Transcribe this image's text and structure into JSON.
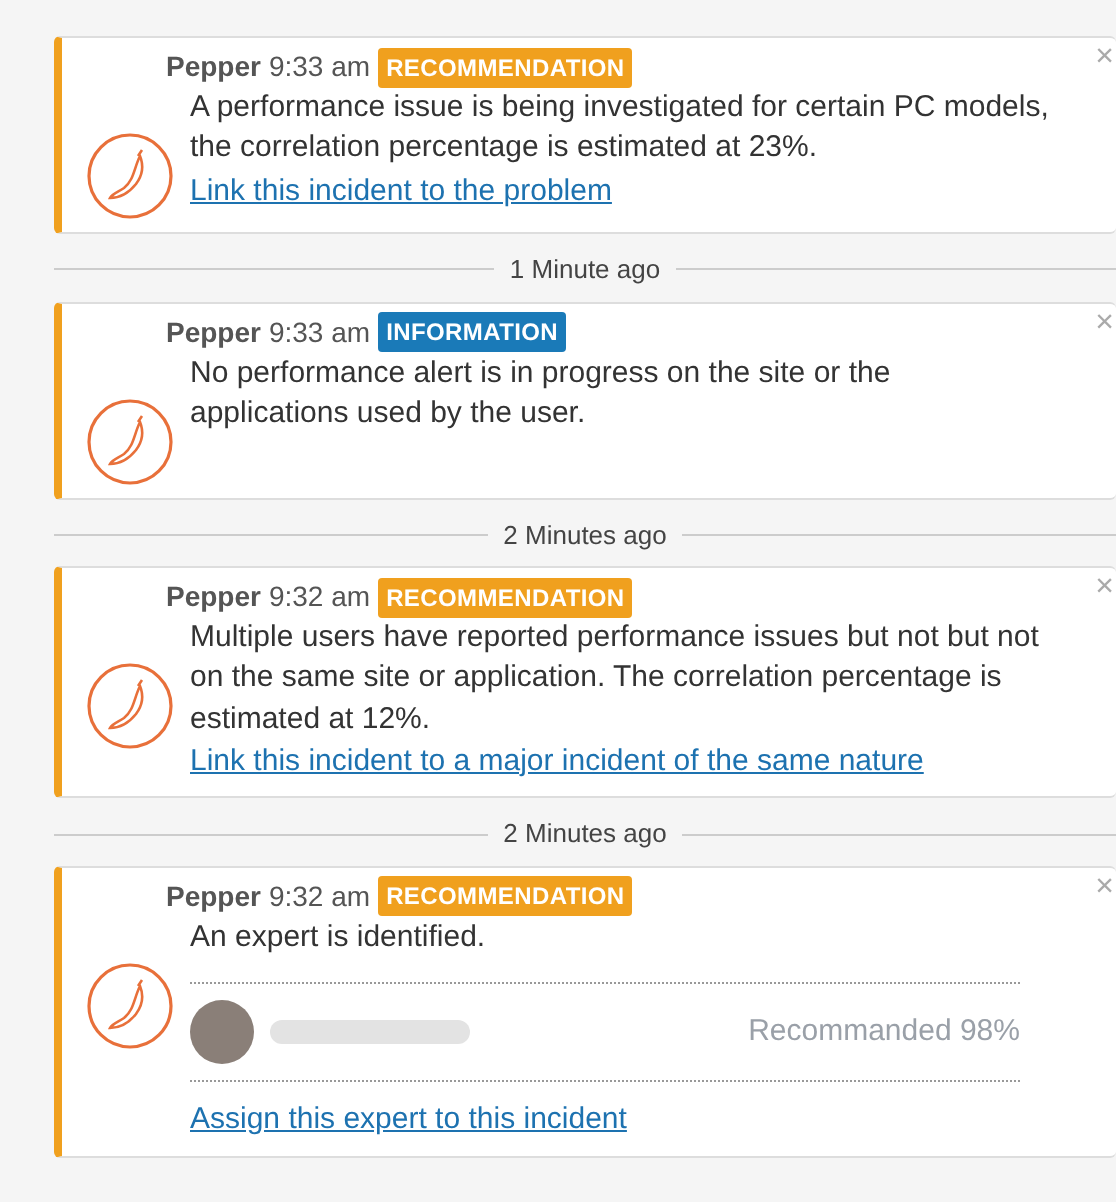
{
  "feed": [
    {
      "kind": "message",
      "author": "Pepper",
      "time": "9:33 am",
      "tag": {
        "label": "RECOMMENDATION",
        "kind": "recommendation"
      },
      "text": "A performance issue is being investigated for certain PC models, the correlation percentage is estimated at 23%.",
      "link": "Link this incident to the problem",
      "close": "×"
    },
    {
      "kind": "separator",
      "label": "1 Minute ago"
    },
    {
      "kind": "message",
      "author": "Pepper",
      "time": "9:33 am",
      "tag": {
        "label": "INFORMATION",
        "kind": "information"
      },
      "text": "No performance alert is in progress on the site or the applications used by the user.",
      "close": "×"
    },
    {
      "kind": "separator",
      "label": "2 Minutes ago"
    },
    {
      "kind": "message",
      "author": "Pepper",
      "time": "9:32 am",
      "tag": {
        "label": "RECOMMENDATION",
        "kind": "recommendation"
      },
      "text": "Multiple users have reported performance issues but not but not on the same site or application. The correlation percentage is estimated at 12%.",
      "link": "Link this incident to a major incident of the same nature",
      "close": "×"
    },
    {
      "kind": "separator",
      "label": "2 Minutes ago"
    },
    {
      "kind": "message",
      "author": "Pepper",
      "time": "9:32 am",
      "tag": {
        "label": "RECOMMENDATION",
        "kind": "recommendation"
      },
      "text": "An expert is identified.",
      "expert": {
        "score": "Recommanded 98%"
      },
      "link": "Assign this expert to this incident",
      "close": "×"
    }
  ]
}
